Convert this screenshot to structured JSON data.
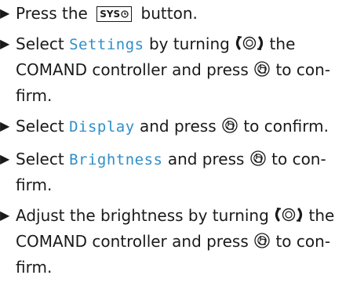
{
  "steps": [
    {
      "parts": [
        "Press the",
        "SYS",
        "button."
      ]
    },
    {
      "parts": [
        "Select",
        "Settings",
        "by turning",
        "the COMAND controller and press",
        "to con-",
        "firm."
      ]
    },
    {
      "parts": [
        "Select",
        "Display",
        "and press",
        "to confirm."
      ]
    },
    {
      "parts": [
        "Select",
        "Brightness",
        "and press",
        "to con-",
        "firm."
      ]
    },
    {
      "parts": [
        "Adjust the brightness by turning",
        "the COMAND controller and press",
        "to con-",
        "firm."
      ]
    }
  ],
  "icons": {
    "bullet": "right-triangle-bullet",
    "sys_button": "sys-clock-button",
    "turn_controller": "turn-controller-icon",
    "press_controller": "press-controller-icon"
  }
}
